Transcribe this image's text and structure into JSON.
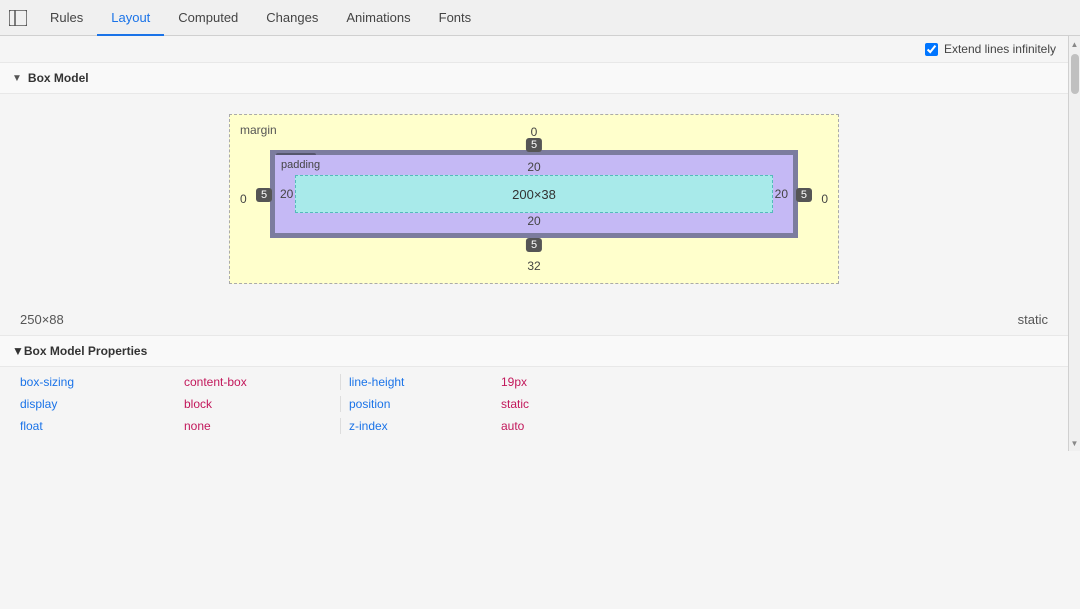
{
  "nav": {
    "icon_label": "panel-icon",
    "tabs": [
      {
        "label": "Rules",
        "active": false
      },
      {
        "label": "Layout",
        "active": true
      },
      {
        "label": "Computed",
        "active": false
      },
      {
        "label": "Changes",
        "active": false
      },
      {
        "label": "Animations",
        "active": false
      },
      {
        "label": "Fonts",
        "active": false
      }
    ]
  },
  "extend_lines": {
    "checkbox_checked": true,
    "label": "Extend lines infinitely"
  },
  "box_model": {
    "section_label": "Box Model",
    "margin": {
      "label": "margin",
      "top": "0",
      "bottom": "32",
      "left": "0",
      "right": "0"
    },
    "border": {
      "label": "border",
      "top_badge": "5",
      "bottom_badge": "5",
      "left_badge": "5",
      "right_badge": "5"
    },
    "padding": {
      "label": "padding",
      "top": "20",
      "bottom": "20",
      "left": "20",
      "right": "20"
    },
    "content": {
      "label": "200×38"
    }
  },
  "dimensions": {
    "size": "250×88",
    "position": "static"
  },
  "box_model_properties": {
    "section_label": "Box Model Properties",
    "properties": [
      {
        "name": "box-sizing",
        "value": "content-box",
        "name2": "line-height",
        "value2": "19px"
      },
      {
        "name": "display",
        "value": "block",
        "name2": "position",
        "value2": "static"
      },
      {
        "name": "float",
        "value": "none",
        "name2": "z-index",
        "value2": "auto"
      }
    ]
  }
}
